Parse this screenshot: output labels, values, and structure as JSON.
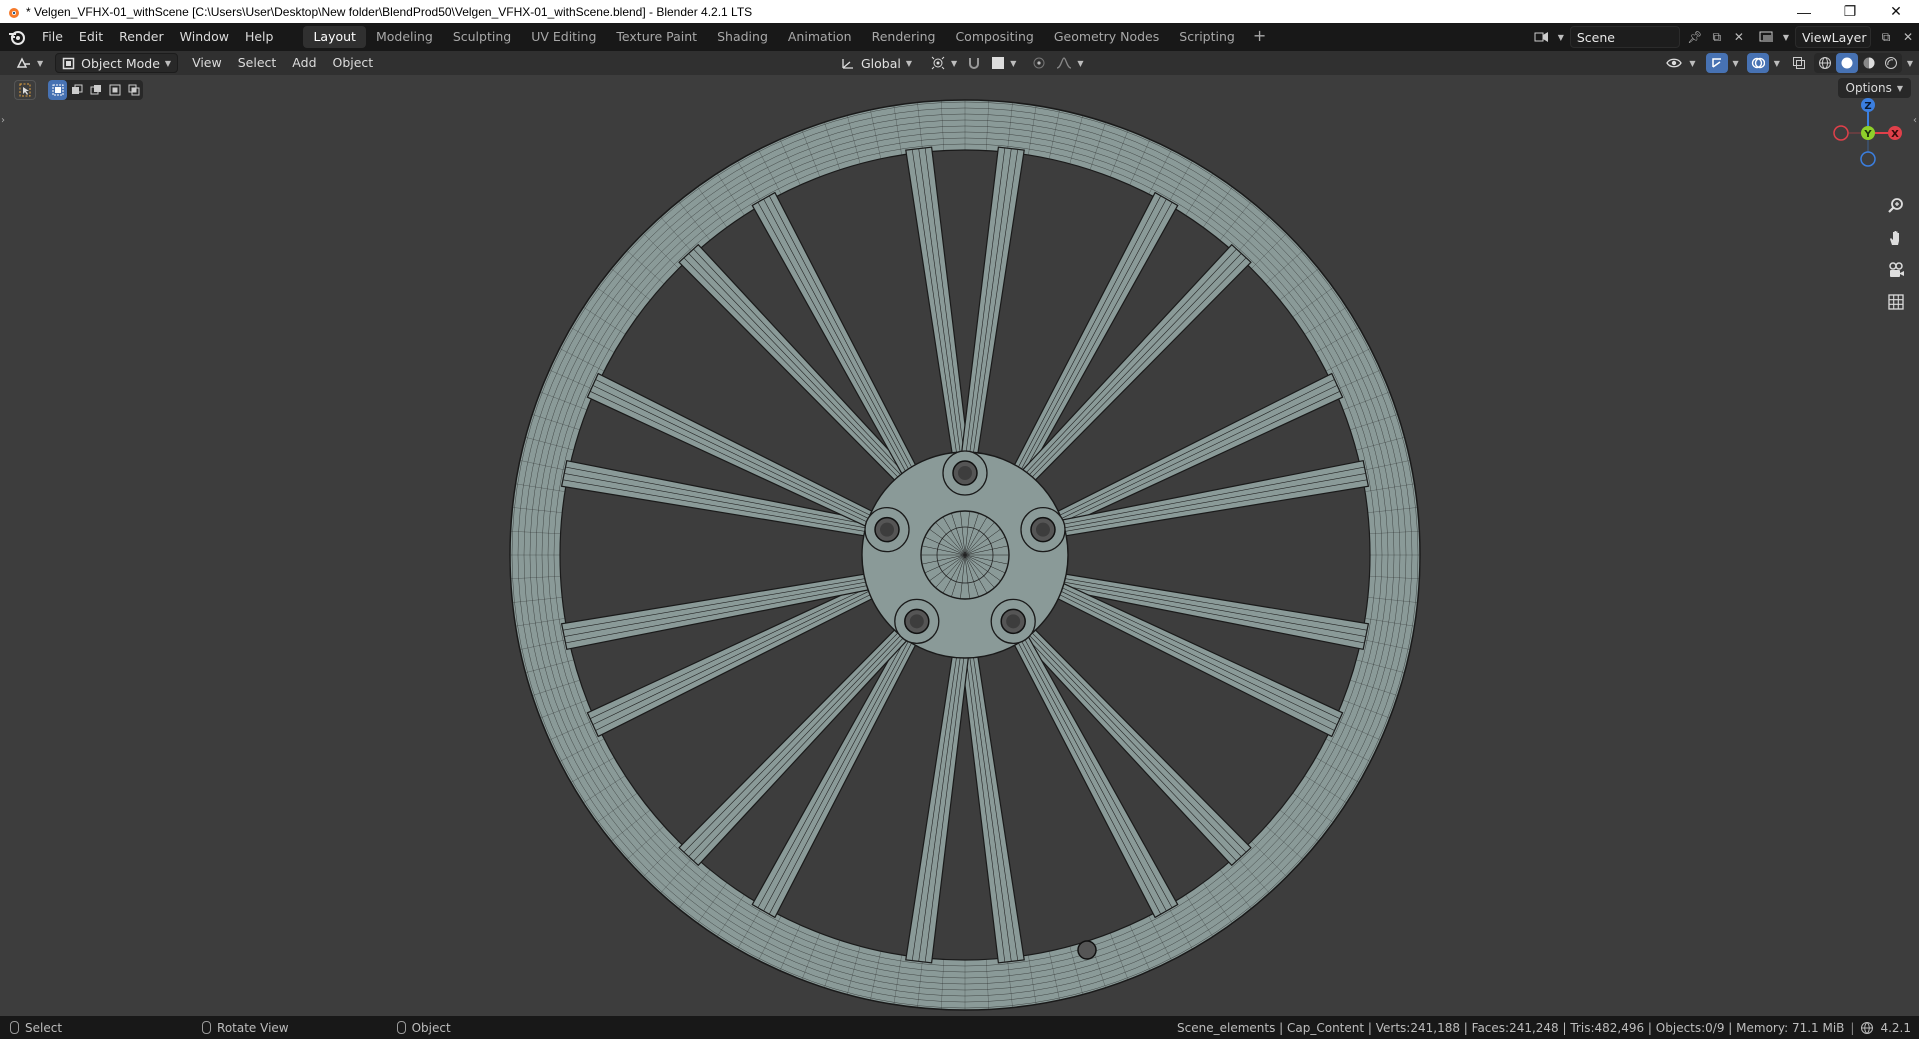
{
  "window": {
    "title": "* Velgen_VFHX-01_withScene [C:\\Users\\User\\Desktop\\New folder\\BlendProd50\\Velgen_VFHX-01_withScene.blend] - Blender 4.2.1 LTS",
    "minimize": "—",
    "maximize": "❐",
    "close": "✕"
  },
  "menu": [
    "File",
    "Edit",
    "Render",
    "Window",
    "Help"
  ],
  "workspaces": [
    "Layout",
    "Modeling",
    "Sculpting",
    "UV Editing",
    "Texture Paint",
    "Shading",
    "Animation",
    "Rendering",
    "Compositing",
    "Geometry Nodes",
    "Scripting"
  ],
  "active_workspace": "Layout",
  "scene": {
    "name": "Scene",
    "view_layer": "ViewLayer"
  },
  "viewport_header": {
    "mode": "Object Mode",
    "menus": [
      "View",
      "Select",
      "Add",
      "Object"
    ],
    "orientation": "Global"
  },
  "viewport": {
    "options_label": "Options",
    "gizmo": {
      "z": "Z",
      "y": "Y",
      "x": "X"
    }
  },
  "status": {
    "left": [
      "Select",
      "Rotate View",
      "Object"
    ],
    "info": "Scene_elements | Cap_Content | Verts:241,188 | Faces:241,248 | Tris:482,496 | Objects:0/9 | Memory: 71.1 MiB",
    "version": "4.2.1"
  },
  "colors": {
    "accent": "#4772b3",
    "axis_x": "#e0404a",
    "axis_y": "#8ed02a",
    "axis_z": "#3b7fe0",
    "wheel": "#8a9a98"
  }
}
